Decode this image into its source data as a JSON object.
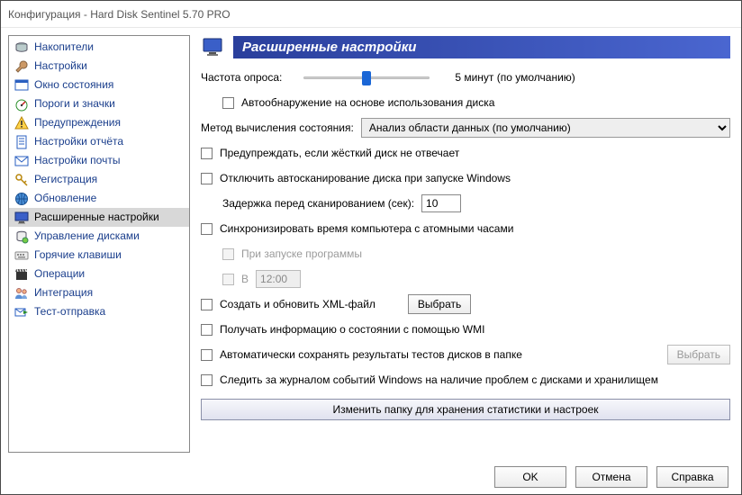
{
  "window": {
    "title": "Конфигурация  -  Hard Disk Sentinel 5.70 PRO"
  },
  "sidebar": {
    "items": [
      {
        "label": "Накопители",
        "icon": "disks"
      },
      {
        "label": "Настройки",
        "icon": "wrench"
      },
      {
        "label": "Окно состояния",
        "icon": "window"
      },
      {
        "label": "Пороги и значки",
        "icon": "gauge"
      },
      {
        "label": "Предупреждения",
        "icon": "warning"
      },
      {
        "label": "Настройки отчёта",
        "icon": "report"
      },
      {
        "label": "Настройки почты",
        "icon": "mail"
      },
      {
        "label": "Регистрация",
        "icon": "key"
      },
      {
        "label": "Обновление",
        "icon": "globe"
      },
      {
        "label": "Расширенные настройки",
        "icon": "monitor",
        "selected": true
      },
      {
        "label": "Управление дисками",
        "icon": "manage"
      },
      {
        "label": "Горячие клавиши",
        "icon": "keyboard"
      },
      {
        "label": "Операции",
        "icon": "clapper"
      },
      {
        "label": "Интеграция",
        "icon": "users"
      },
      {
        "label": "Тест-отправка",
        "icon": "send"
      }
    ]
  },
  "header": {
    "title": "Расширенные настройки"
  },
  "main": {
    "polling_label": "Частота опроса:",
    "polling_value": "5 минут (по умолчанию)",
    "autodetect": "Автообнаружение на основе использования диска",
    "method_label": "Метод вычисления состояния:",
    "method_value": "Анализ области данных (по умолчанию)",
    "warn_noresponse": "Предупреждать, если жёсткий диск не отвечает",
    "disable_autoscan": "Отключить автосканирование диска при запуске Windows",
    "scan_delay_label": "Задержка перед сканированием (сек):",
    "scan_delay_value": "10",
    "sync_time": "Синхронизировать время компьютера с атомными часами",
    "on_startup": "При запуске программы",
    "at_label": "В",
    "at_value": "12:00",
    "create_xml": "Создать и обновить XML-файл",
    "select_btn": "Выбрать",
    "wmi": "Получать информацию о состоянии с помощью WMI",
    "autosave_tests": "Автоматически сохранять результаты тестов дисков в папке",
    "select_btn2": "Выбрать",
    "monitor_eventlog": "Следить за журналом событий Windows на наличие проблем с дисками и хранилищем",
    "change_folder": "Изменить папку для хранения статистики и настроек"
  },
  "footer": {
    "ok": "OK",
    "cancel": "Отмена",
    "help": "Справка"
  }
}
